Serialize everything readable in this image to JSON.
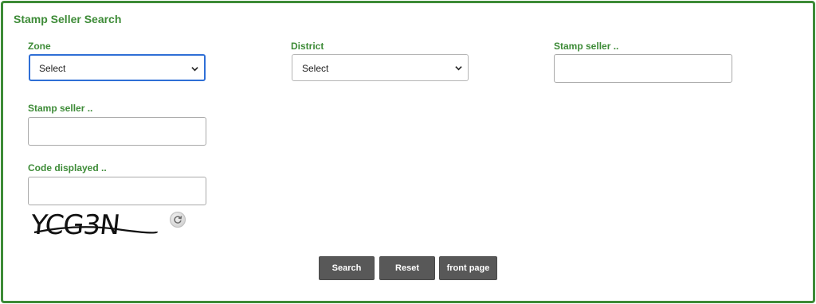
{
  "panel": {
    "title": "Stamp Seller Search"
  },
  "fields": {
    "zone": {
      "label": "Zone",
      "value": "Select"
    },
    "district": {
      "label": "District",
      "value": "Select"
    },
    "stamp_seller_1": {
      "label": "Stamp seller ..",
      "value": ""
    },
    "stamp_seller_2": {
      "label": "Stamp seller ..",
      "value": ""
    },
    "code_displayed": {
      "label": "Code displayed ..",
      "value": ""
    }
  },
  "captcha": {
    "text": "YCG3N"
  },
  "buttons": {
    "search": "Search",
    "reset": "Reset",
    "front_page": "front page"
  },
  "colors": {
    "accent": "#3d8b37",
    "button_bg": "#585858",
    "focus": "#2f6fd6"
  },
  "icons": {
    "refresh": "refresh-icon",
    "dropdown": "chevron-down-icon"
  }
}
